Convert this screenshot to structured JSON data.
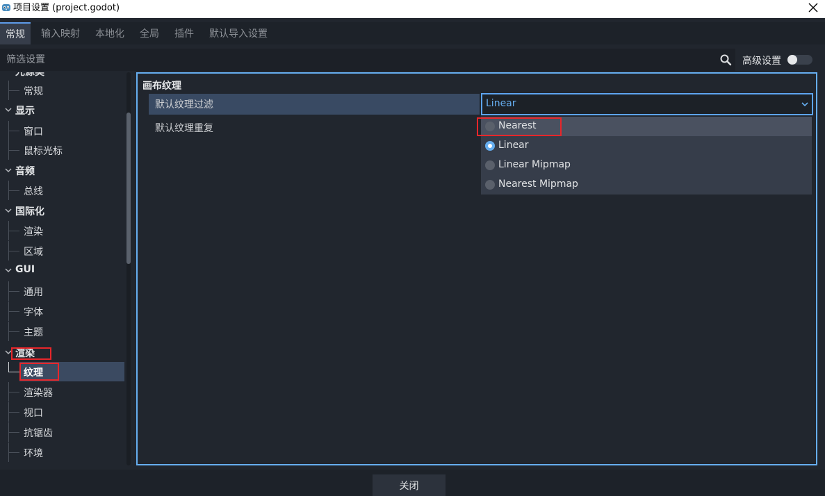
{
  "window": {
    "title": "项目设置 (project.godot)"
  },
  "tabs": [
    {
      "label": "常规"
    },
    {
      "label": "输入映射"
    },
    {
      "label": "本地化"
    },
    {
      "label": "全局"
    },
    {
      "label": "插件"
    },
    {
      "label": "默认导入设置"
    }
  ],
  "filter": {
    "placeholder": "筛选设置",
    "advanced_label": "高级设置",
    "advanced_enabled": false
  },
  "sidebar": {
    "items": [
      {
        "label": "光源类",
        "type": "category"
      },
      {
        "label": "常规",
        "type": "child"
      },
      {
        "label": "显示",
        "type": "category"
      },
      {
        "label": "窗口",
        "type": "child"
      },
      {
        "label": "鼠标光标",
        "type": "child"
      },
      {
        "label": "音频",
        "type": "category"
      },
      {
        "label": "总线",
        "type": "child"
      },
      {
        "label": "国际化",
        "type": "category"
      },
      {
        "label": "渲染",
        "type": "child"
      },
      {
        "label": "区域",
        "type": "child"
      },
      {
        "label": "GUI",
        "type": "category"
      },
      {
        "label": "通用",
        "type": "child"
      },
      {
        "label": "字体",
        "type": "child"
      },
      {
        "label": "主题",
        "type": "child"
      },
      {
        "label": "渲染",
        "type": "category"
      },
      {
        "label": "纹理",
        "type": "child",
        "selected": true
      },
      {
        "label": "渲染器",
        "type": "child"
      },
      {
        "label": "视口",
        "type": "child"
      },
      {
        "label": "抗锯齿",
        "type": "child"
      },
      {
        "label": "环境",
        "type": "child"
      }
    ]
  },
  "main": {
    "section_title": "画布纹理",
    "properties": [
      {
        "label": "默认纹理过滤"
      },
      {
        "label": "默认纹理重复"
      }
    ],
    "filter_dropdown": {
      "value": "Linear",
      "options": [
        {
          "label": "Nearest",
          "checked": false
        },
        {
          "label": "Linear",
          "checked": true
        },
        {
          "label": "Linear Mipmap",
          "checked": false
        },
        {
          "label": "Nearest Mipmap",
          "checked": false
        }
      ]
    }
  },
  "footer": {
    "close_label": "关闭"
  },
  "colors": {
    "accent": "#66aef0",
    "highlight_box": "#e8262a",
    "background": "#21262e",
    "selected_row": "#394a63"
  }
}
